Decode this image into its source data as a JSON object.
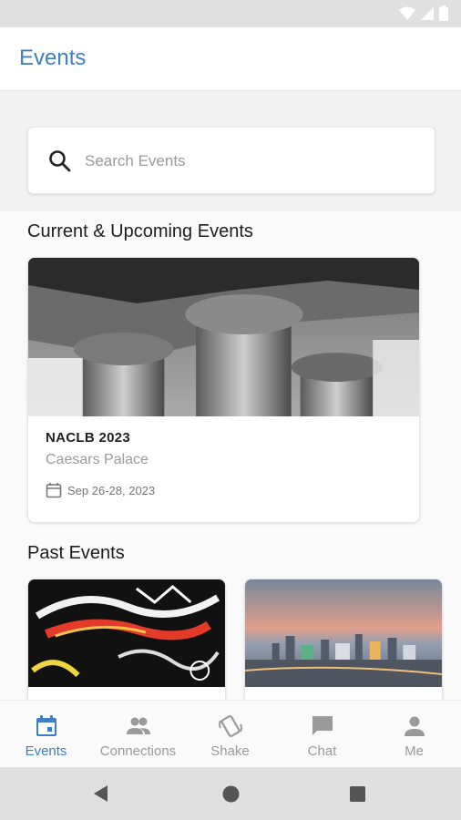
{
  "app": {
    "title": "Events"
  },
  "search": {
    "placeholder": "Search Events"
  },
  "sections": {
    "current": "Current & Upcoming Events",
    "past": "Past Events"
  },
  "current_events": [
    {
      "name": "NACLB 2023",
      "venue": "Caesars Palace",
      "dates": "Sep 26-28, 2023",
      "image_icon": "classical-columns-photo"
    }
  ],
  "past_events": [
    {
      "image_icon": "graffiti-photo"
    },
    {
      "image_icon": "city-skyline-photo"
    }
  ],
  "nav": [
    {
      "label": "Events",
      "icon": "calendar-icon",
      "active": true
    },
    {
      "label": "Connections",
      "icon": "people-icon",
      "active": false
    },
    {
      "label": "Shake",
      "icon": "shake-phone-icon",
      "active": false
    },
    {
      "label": "Chat",
      "icon": "chat-bubble-icon",
      "active": false
    },
    {
      "label": "Me",
      "icon": "person-icon",
      "active": false
    }
  ],
  "colors": {
    "accent": "#3f7fc1",
    "inactive": "#9a9a9a"
  }
}
